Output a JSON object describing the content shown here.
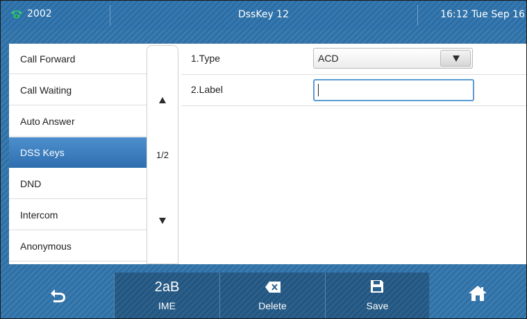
{
  "status_bar": {
    "account": "2002",
    "title": "DssKey 12",
    "datetime": "16:12 Tue Sep 16"
  },
  "menu": {
    "items": [
      {
        "label": "Call Forward",
        "active": false
      },
      {
        "label": "Call Waiting",
        "active": false
      },
      {
        "label": "Auto Answer",
        "active": false
      },
      {
        "label": "DSS Keys",
        "active": true
      },
      {
        "label": "DND",
        "active": false
      },
      {
        "label": "Intercom",
        "active": false
      },
      {
        "label": "Anonymous",
        "active": false
      }
    ],
    "page_indicator": "1/2"
  },
  "form": {
    "type_label": "1.Type",
    "type_value": "ACD",
    "label_label": "2.Label",
    "label_value": ""
  },
  "softkeys": {
    "ime_top": "2aB",
    "ime_label": "IME",
    "delete_label": "Delete",
    "save_label": "Save"
  },
  "colors": {
    "accent": "#3a7bb0",
    "active_item": "#3f82c2",
    "phone_icon": "#2ecc71"
  }
}
